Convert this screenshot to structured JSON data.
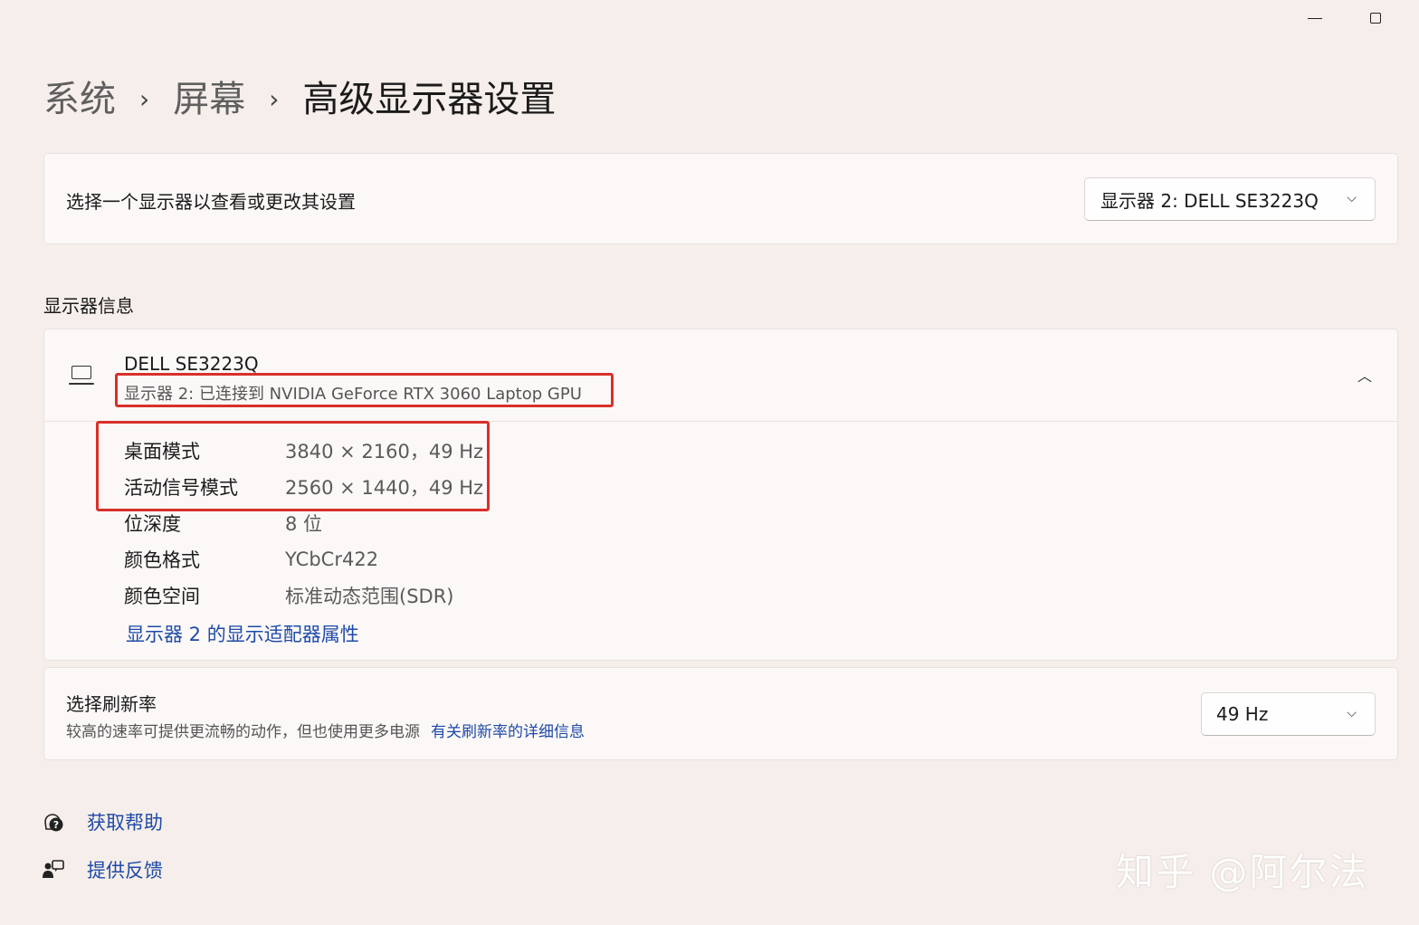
{
  "window": {
    "minimize_glyph": "—",
    "maximize_glyph": "□"
  },
  "breadcrumb": {
    "item1": "系统",
    "item2": "屏幕",
    "current": "高级显示器设置",
    "separator": "›"
  },
  "select_monitor": {
    "label": "选择一个显示器以查看或更改其设置",
    "selected": "显示器 2: DELL SE3223Q",
    "chevron": "⌵"
  },
  "display_info": {
    "section_title": "显示器信息",
    "monitor_name": "DELL SE3223Q",
    "monitor_sub": "显示器 2: 已连接到 NVIDIA GeForce RTX 3060 Laptop GPU",
    "collapse_glyph": "︿",
    "rows": [
      {
        "label": "桌面模式",
        "value": "3840 × 2160，49 Hz"
      },
      {
        "label": "活动信号模式",
        "value": "2560 × 1440，49 Hz"
      },
      {
        "label": "位深度",
        "value": "8 位"
      },
      {
        "label": "颜色格式",
        "value": "YCbCr422"
      },
      {
        "label": "颜色空间",
        "value": "标准动态范围(SDR)"
      }
    ],
    "adapter_link": "显示器 2 的显示适配器属性"
  },
  "refresh_rate": {
    "title": "选择刷新率",
    "description": "较高的速率可提供更流畅的动作，但也使用更多电源",
    "link": "有关刷新率的详细信息",
    "selected": "49 Hz",
    "chevron": "⌵"
  },
  "help": {
    "get_help": "获取帮助",
    "feedback": "提供反馈"
  },
  "watermark": "知乎 @阿尔法",
  "colors": {
    "background": "#f6eeea",
    "card": "#fbf8f7",
    "link": "#1f4aa8",
    "highlight": "#d8302b"
  }
}
